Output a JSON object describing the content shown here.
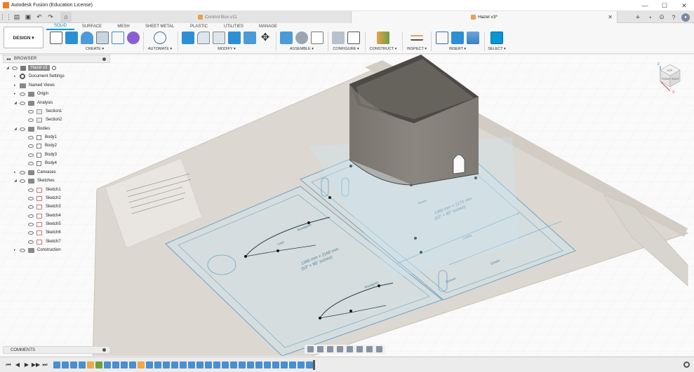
{
  "window": {
    "title": "Autodesk Fusion (Education License)",
    "controls": [
      "—",
      "☐",
      "✕"
    ]
  },
  "tabs": [
    {
      "label": "Control Box v11",
      "active": false
    },
    {
      "label": "Hazel v3*",
      "active": true,
      "close": "✕"
    }
  ],
  "toolbar": {
    "workspace": "DESIGN ▾",
    "workspace_tabs": [
      "SOLID",
      "SURFACE",
      "MESH",
      "SHEET METAL",
      "PLASTIC",
      "UTILITIES",
      "MANAGE"
    ],
    "groups": [
      {
        "label": "CREATE ▾",
        "icons": [
          "sketch-icon",
          "extrude-icon",
          "revolve-icon",
          "hole-icon",
          "pattern-icon",
          "form-icon"
        ]
      },
      {
        "label": "AUTOMATE ▾",
        "icons": [
          "automate-icon"
        ]
      },
      {
        "label": "MODIFY ▾",
        "icons": [
          "press-pull-icon",
          "fillet-icon",
          "shell-icon",
          "combine-icon",
          "replace-face-icon",
          "move-icon"
        ]
      },
      {
        "label": "ASSEMBLE ▾",
        "icons": [
          "new-component-icon",
          "joint-icon",
          "assemble-table-icon"
        ]
      },
      {
        "label": "CONFIGURE ▾",
        "icons": [
          "configure-icon",
          "configure-table-icon"
        ]
      },
      {
        "label": "CONSTRUCT ▾",
        "icons": [
          "plane-icon"
        ]
      },
      {
        "label": "INSPECT ▾",
        "icons": [
          "measure-icon"
        ]
      },
      {
        "label": "INSERT ▾",
        "icons": [
          "insert-derive-icon",
          "insert-icon",
          "insert-image-icon"
        ]
      },
      {
        "label": "SELECT ▾",
        "icons": [
          "select-icon"
        ]
      }
    ]
  },
  "browser": {
    "title": "BROWSER",
    "root": "Hazel v3",
    "items": [
      {
        "label": "Document Settings",
        "icon": "gear-icon"
      },
      {
        "label": "Named Views",
        "icon": "folder-icon"
      },
      {
        "label": "Origin",
        "icon": "folder-icon"
      },
      {
        "label": "Analysis",
        "icon": "folder-icon"
      },
      {
        "label": "Section1",
        "icon": "section-icon"
      },
      {
        "label": "Section2",
        "icon": "section-icon"
      },
      {
        "label": "Bodies",
        "icon": "folder-icon"
      },
      {
        "label": "Body1",
        "icon": "body-icon"
      },
      {
        "label": "Body2",
        "icon": "body-icon"
      },
      {
        "label": "Body3",
        "icon": "body-icon"
      },
      {
        "label": "Body4",
        "icon": "body-icon"
      },
      {
        "label": "Canvases",
        "icon": "folder-icon"
      },
      {
        "label": "Sketches",
        "icon": "folder-icon"
      },
      {
        "label": "Sketch1",
        "icon": "sketch-icon"
      },
      {
        "label": "Sketch2",
        "icon": "sketch-icon"
      },
      {
        "label": "Sketch3",
        "icon": "sketch-icon"
      },
      {
        "label": "Sketch4",
        "icon": "sketch-icon"
      },
      {
        "label": "Sketch5",
        "icon": "sketch-icon"
      },
      {
        "label": "Sketch6",
        "icon": "sketch-icon"
      },
      {
        "label": "Sketch7",
        "icon": "sketch-icon"
      },
      {
        "label": "Construction",
        "icon": "folder-icon"
      }
    ]
  },
  "comments": {
    "title": "COMMENTS"
  },
  "viewport": {
    "viewcube_labels": {
      "top": "TOP",
      "front": "FRONT",
      "right": "RIGHT"
    },
    "axes": {
      "x": "X",
      "z": "Z"
    },
    "sketch_text": {
      "dim_left": "1360 mm × 2160 mm",
      "dim_left_sub": "(53\" × 85\" inches)",
      "dim_right": "1360 mm × 2170 mm",
      "dim_right_sub": "(53\" × 85\" inches)",
      "labels": [
        "Lego",
        "Woodgrain",
        "Woodgrain",
        "Ready",
        "Cables",
        "Divider",
        "Groove"
      ]
    }
  },
  "navbar_icons": [
    "orbit-icon",
    "look-at-icon",
    "pan-icon",
    "zoom-icon",
    "fit-icon",
    "display-mode-icon",
    "grid-icon",
    "viewports-icon"
  ],
  "timeline": {
    "controls": [
      "⏮",
      "◀",
      "▶",
      "▶▶",
      "⏭"
    ],
    "features": [
      "s",
      "s",
      "s",
      "s",
      "e",
      "c",
      "s",
      "s",
      "s",
      "s",
      "e",
      "s",
      "s",
      "s",
      "s",
      "s",
      "s",
      "s",
      "s",
      "s",
      "s",
      "s",
      "s",
      "s",
      "s",
      "s",
      "s",
      "s",
      "s",
      "s",
      "s"
    ]
  },
  "colors": {
    "accent": "#0696d7",
    "sketch_line": "#6aa5c7",
    "body_fill": "#7a7670",
    "paper": "#e2ddd6"
  }
}
